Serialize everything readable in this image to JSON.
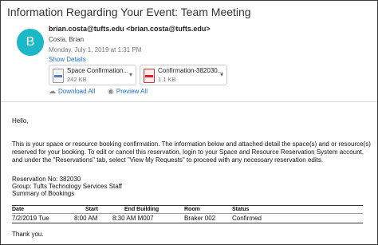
{
  "email": {
    "subject": "Information Regarding Your Event: Team Meeting",
    "sender": {
      "initial": "B",
      "address_line": "brian.costa@tufts.edu <brian.costa@tufts.edu>",
      "name": "Costa, Brian",
      "date": "Monday, July 1, 2019 at 1:31 PM",
      "show_details": "Show Details"
    },
    "attachments": [
      {
        "name": "Space Confirmation...",
        "size": "242 KB",
        "icon": "document-icon"
      },
      {
        "name": "Confirmation-382030...",
        "size": "1.1 KB",
        "icon": "pdf-icon"
      }
    ],
    "actions": {
      "download_all": "Download All",
      "preview_all": "Preview All"
    },
    "body": {
      "greeting": "Hello,",
      "paragraph": "This is your space or resource booking confirmation. The information below and attached detail the space(s) and or resource(s) reserved for your booking. To edit or cancel this reservation, login to your Space and Resource Reservation System account, and under the \"Reservations\" tab, select \"View My Requests\" to proceed with any necessary reservation edits.",
      "reservation_no": "Reservation No: 382030",
      "group": "Group: Tufts Technology Services Staff",
      "summary": "Summary of Bookings",
      "table": {
        "headers": [
          "Date",
          "Start",
          "End Building",
          "Room",
          "Status"
        ],
        "rows": [
          [
            "7/2/2019 Tue",
            "8:00 AM",
            "8:30 AM M007",
            "Braker 002",
            "Confirmed"
          ]
        ]
      },
      "closing": "Thank you."
    }
  }
}
